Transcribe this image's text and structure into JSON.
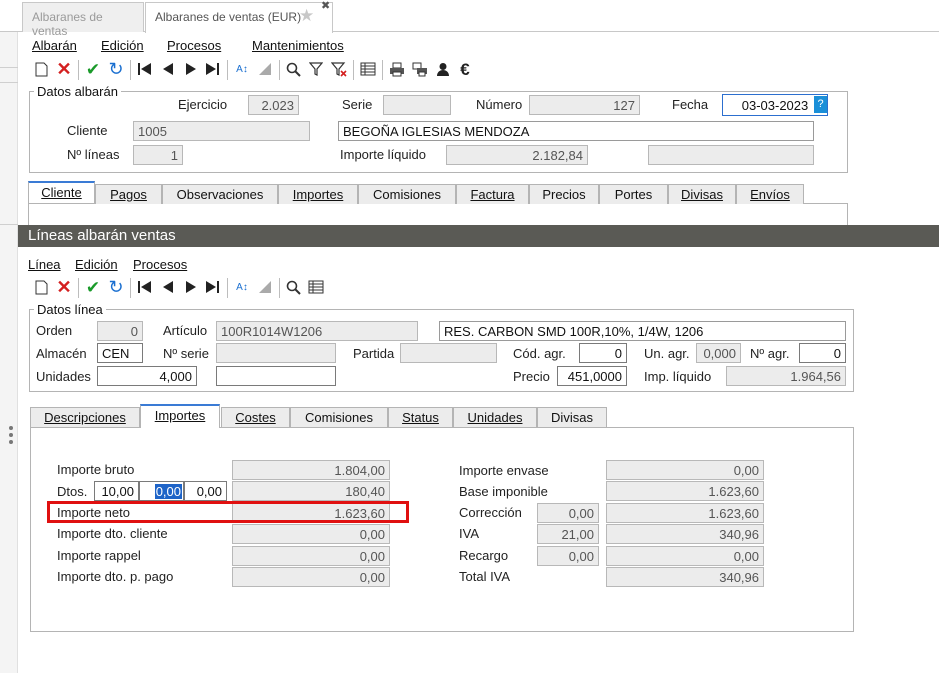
{
  "window_tabs": [
    {
      "label": "Albaranes de ventas"
    },
    {
      "label": "Albaranes de ventas (EUR)"
    }
  ],
  "header_menu": [
    "Albarán",
    "Edición",
    "Procesos",
    "Mantenimientos"
  ],
  "header_toolbar_icons": [
    "new-icon",
    "delete-icon",
    "confirm-icon",
    "undo-icon",
    "first-icon",
    "previous-icon",
    "next-icon",
    "last-icon",
    "sort-icon",
    "filter-off-icon",
    "search-icon",
    "filter-icon",
    "clear-filter-icon",
    "table-view-icon",
    "print-icon",
    "print-labels-icon",
    "user-icon",
    "euro-icon"
  ],
  "datos_albaran": {
    "legend": "Datos albarán",
    "ejercicio_label": "Ejercicio",
    "ejercicio": "2.023",
    "serie_label": "Serie",
    "serie": "",
    "numero_label": "Número",
    "numero": "127",
    "fecha_label": "Fecha",
    "fecha": "03-03-2023",
    "fecha_help": "?",
    "cliente_label": "Cliente",
    "cliente_code": "1005",
    "cliente_name": "BEGOÑA IGLESIAS MENDOZA",
    "nlineas_label": "Nº líneas",
    "nlineas": "1",
    "importe_liquido_label": "Importe líquido",
    "importe_liquido": "2.182,84",
    "extra": ""
  },
  "header_tabs": [
    "Cliente",
    "Pagos",
    "Observaciones",
    "Importes",
    "Comisiones",
    "Factura",
    "Precios",
    "Portes",
    "Divisas",
    "Envíos"
  ],
  "lines_section_title": "Líneas albarán ventas",
  "lines_menu": [
    "Línea",
    "Edición",
    "Procesos"
  ],
  "lines_toolbar_icons": [
    "new-icon",
    "delete-icon",
    "confirm-icon",
    "undo-icon",
    "first-icon",
    "previous-icon",
    "next-icon",
    "last-icon",
    "sort-icon",
    "filter-off-icon",
    "search-icon",
    "table-view-icon"
  ],
  "datos_linea": {
    "legend": "Datos línea",
    "orden_label": "Orden",
    "orden": "0",
    "articulo_label": "Artículo",
    "articulo_code": "100R1014W1206",
    "articulo_desc": "RES. CARBON SMD 100R,10%, 1/4W, 1206",
    "almacen_label": "Almacén",
    "almacen": "CEN",
    "nserie_label": "Nº serie",
    "nserie": "",
    "partida_label": "Partida",
    "partida": "",
    "codagr_label": "Cód. agr.",
    "codagr": "0",
    "unagr_label": "Un. agr.",
    "unagr": "0,000",
    "nagr_label": "Nº agr.",
    "nagr": "0",
    "unidades_label": "Unidades",
    "unidades": "4,000",
    "unidades_extra": "",
    "precio_label": "Precio",
    "precio": "451,0000",
    "implq_label": "Imp. líquido",
    "implq": "1.964,56"
  },
  "line_tabs": [
    "Descripciones",
    "Importes",
    "Costes",
    "Comisiones",
    "Status",
    "Unidades",
    "Divisas"
  ],
  "importes": {
    "bruto_label": "Importe bruto",
    "bruto": "1.804,00",
    "dtos_label": "Dtos.",
    "dto1": "10,00",
    "dto2": "0,00",
    "dto3": "0,00",
    "dtos_total": "180,40",
    "neto_label": "Importe neto",
    "neto": "1.623,60",
    "dto_cliente_label": "Importe dto. cliente",
    "dto_cliente": "0,00",
    "rappel_label": "Importe rappel",
    "rappel": "0,00",
    "dto_pago_label": "Importe dto. p. pago",
    "dto_pago": "0,00",
    "envase_label": "Importe envase",
    "envase": "0,00",
    "base_label": "Base imponible",
    "base": "1.623,60",
    "correccion_label": "Corrección",
    "correccion_pct": "0,00",
    "correccion": "1.623,60",
    "iva_label": "IVA",
    "iva_pct": "21,00",
    "iva": "340,96",
    "recargo_label": "Recargo",
    "recargo_pct": "0,00",
    "recargo": "0,00",
    "total_iva_label": "Total IVA",
    "total_iva": "340,96"
  },
  "colors": {
    "accent": "#1e64c8",
    "section_bar": "#5a5a55",
    "highlight": "#e01010"
  }
}
